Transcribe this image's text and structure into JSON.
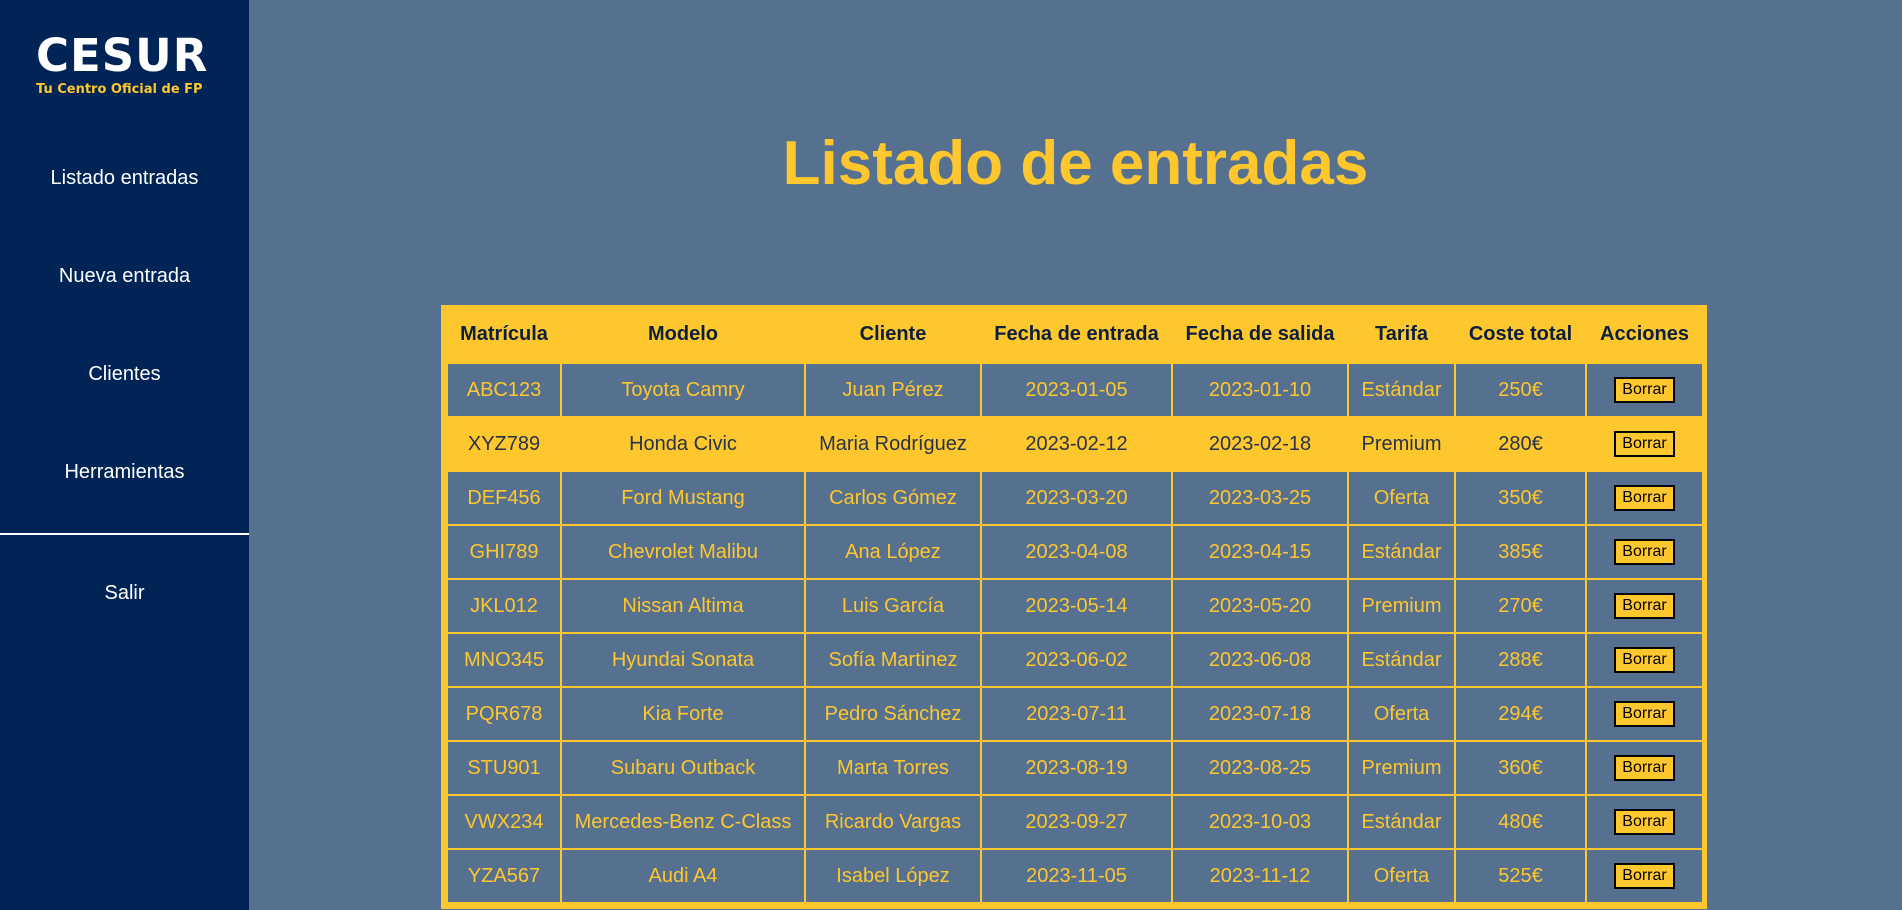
{
  "logo": {
    "name": "CESUR",
    "tagline": "Tu Centro Oficial de FP"
  },
  "nav": {
    "items": [
      {
        "label": "Listado entradas"
      },
      {
        "label": "Nueva entrada"
      },
      {
        "label": "Clientes"
      },
      {
        "label": "Herramientas"
      }
    ],
    "logout": "Salir"
  },
  "page": {
    "title": "Listado de entradas"
  },
  "table": {
    "headers": [
      "Matrícula",
      "Modelo",
      "Cliente",
      "Fecha de entrada",
      "Fecha de salida",
      "Tarifa",
      "Coste total",
      "Acciones"
    ],
    "action_label": "Borrar",
    "rows": [
      [
        "ABC123",
        "Toyota Camry",
        "Juan Pérez",
        "2023-01-05",
        "2023-01-10",
        "Estándar",
        "250€"
      ],
      [
        "XYZ789",
        "Honda Civic",
        "Maria Rodríguez",
        "2023-02-12",
        "2023-02-18",
        "Premium",
        "280€"
      ],
      [
        "DEF456",
        "Ford Mustang",
        "Carlos Gómez",
        "2023-03-20",
        "2023-03-25",
        "Oferta",
        "350€"
      ],
      [
        "GHI789",
        "Chevrolet Malibu",
        "Ana López",
        "2023-04-08",
        "2023-04-15",
        "Estándar",
        "385€"
      ],
      [
        "JKL012",
        "Nissan Altima",
        "Luis García",
        "2023-05-14",
        "2023-05-20",
        "Premium",
        "270€"
      ],
      [
        "MNO345",
        "Hyundai Sonata",
        "Sofía Martinez",
        "2023-06-02",
        "2023-06-08",
        "Estándar",
        "288€"
      ],
      [
        "PQR678",
        "Kia Forte",
        "Pedro Sánchez",
        "2023-07-11",
        "2023-07-18",
        "Oferta",
        "294€"
      ],
      [
        "STU901",
        "Subaru Outback",
        "Marta Torres",
        "2023-08-19",
        "2023-08-25",
        "Premium",
        "360€"
      ],
      [
        "VWX234",
        "Mercedes-Benz C-Class",
        "Ricardo Vargas",
        "2023-09-27",
        "2023-10-03",
        "Estándar",
        "480€"
      ],
      [
        "YZA567",
        "Audi A4",
        "Isabel López",
        "2023-11-05",
        "2023-11-12",
        "Oferta",
        "525€"
      ]
    ],
    "highlighted_row": 1
  },
  "colors": {
    "sidebar_bg": "#002455",
    "page_bg": "#56708f",
    "accent": "#fec72e"
  }
}
